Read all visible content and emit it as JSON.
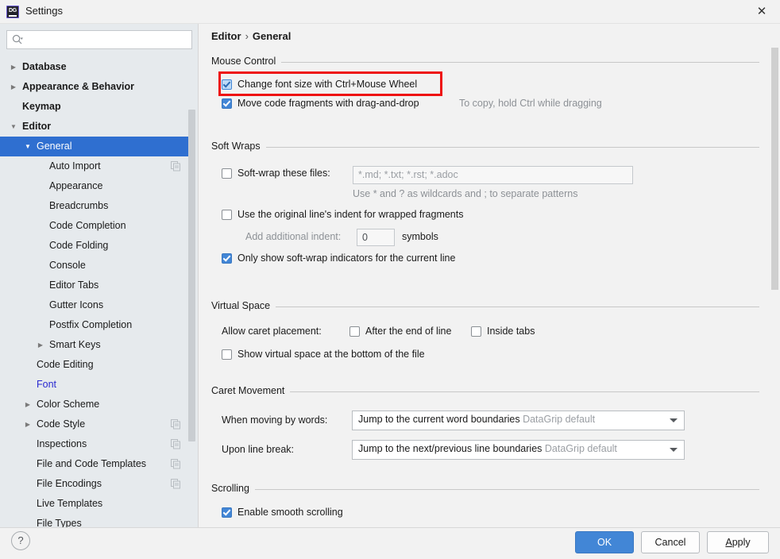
{
  "window": {
    "title": "Settings",
    "app_icon": "datagrip-icon",
    "app_icon_text": "DG",
    "close_label": "✕"
  },
  "sidebar": {
    "search": {
      "placeholder": "",
      "value": "",
      "icon": "search-icon"
    },
    "items": [
      {
        "label": "Database",
        "level": 0,
        "arrow": "collapsed",
        "bold": true,
        "selected": false,
        "copy_icon": false
      },
      {
        "label": "Appearance & Behavior",
        "level": 0,
        "arrow": "collapsed",
        "bold": true,
        "selected": false,
        "copy_icon": false
      },
      {
        "label": "Keymap",
        "level": 0,
        "arrow": "none",
        "bold": true,
        "selected": false,
        "copy_icon": false
      },
      {
        "label": "Editor",
        "level": 0,
        "arrow": "expanded",
        "bold": true,
        "selected": false,
        "copy_icon": false
      },
      {
        "label": "General",
        "level": 1,
        "arrow": "expanded",
        "bold": false,
        "selected": true,
        "copy_icon": false
      },
      {
        "label": "Auto Import",
        "level": 2,
        "arrow": "none",
        "bold": false,
        "selected": false,
        "copy_icon": true
      },
      {
        "label": "Appearance",
        "level": 2,
        "arrow": "none",
        "bold": false,
        "selected": false,
        "copy_icon": false
      },
      {
        "label": "Breadcrumbs",
        "level": 2,
        "arrow": "none",
        "bold": false,
        "selected": false,
        "copy_icon": false
      },
      {
        "label": "Code Completion",
        "level": 2,
        "arrow": "none",
        "bold": false,
        "selected": false,
        "copy_icon": false
      },
      {
        "label": "Code Folding",
        "level": 2,
        "arrow": "none",
        "bold": false,
        "selected": false,
        "copy_icon": false
      },
      {
        "label": "Console",
        "level": 2,
        "arrow": "none",
        "bold": false,
        "selected": false,
        "copy_icon": false
      },
      {
        "label": "Editor Tabs",
        "level": 2,
        "arrow": "none",
        "bold": false,
        "selected": false,
        "copy_icon": false
      },
      {
        "label": "Gutter Icons",
        "level": 2,
        "arrow": "none",
        "bold": false,
        "selected": false,
        "copy_icon": false
      },
      {
        "label": "Postfix Completion",
        "level": 2,
        "arrow": "none",
        "bold": false,
        "selected": false,
        "copy_icon": false
      },
      {
        "label": "Smart Keys",
        "level": 2,
        "arrow": "collapsed",
        "bold": false,
        "selected": false,
        "copy_icon": false
      },
      {
        "label": "Code Editing",
        "level": 1,
        "arrow": "none",
        "bold": false,
        "selected": false,
        "copy_icon": false
      },
      {
        "label": "Font",
        "level": 1,
        "arrow": "none",
        "bold": false,
        "selected": false,
        "copy_icon": false,
        "link": true
      },
      {
        "label": "Color Scheme",
        "level": 1,
        "arrow": "collapsed",
        "bold": false,
        "selected": false,
        "copy_icon": false
      },
      {
        "label": "Code Style",
        "level": 1,
        "arrow": "collapsed",
        "bold": false,
        "selected": false,
        "copy_icon": true
      },
      {
        "label": "Inspections",
        "level": 1,
        "arrow": "none",
        "bold": false,
        "selected": false,
        "copy_icon": true
      },
      {
        "label": "File and Code Templates",
        "level": 1,
        "arrow": "none",
        "bold": false,
        "selected": false,
        "copy_icon": true
      },
      {
        "label": "File Encodings",
        "level": 1,
        "arrow": "none",
        "bold": false,
        "selected": false,
        "copy_icon": true
      },
      {
        "label": "Live Templates",
        "level": 1,
        "arrow": "none",
        "bold": false,
        "selected": false,
        "copy_icon": false
      },
      {
        "label": "File Types",
        "level": 1,
        "arrow": "none",
        "bold": false,
        "selected": false,
        "copy_icon": false
      }
    ]
  },
  "main": {
    "breadcrumb": {
      "parent": "Editor",
      "separator": "›",
      "current": "General"
    },
    "mouse_control": {
      "title": "Mouse Control",
      "change_font_size": {
        "label": "Change font size with Ctrl+Mouse Wheel",
        "checked": true
      },
      "move_fragments": {
        "label": "Move code fragments with drag-and-drop",
        "checked": true
      },
      "move_fragments_hint": "To copy, hold Ctrl while dragging"
    },
    "soft_wraps": {
      "title": "Soft Wraps",
      "soft_wrap_files": {
        "label": "Soft-wrap these files:",
        "checked": false
      },
      "soft_wrap_files_value": "*.md; *.txt; *.rst; *.adoc",
      "wildcard_hint": "Use * and ? as wildcards and ; to separate patterns",
      "original_indent": {
        "label": "Use the original line's indent for wrapped fragments",
        "checked": false
      },
      "additional_indent_label": "Add additional indent:",
      "additional_indent_value": "0",
      "symbols_label": "symbols",
      "only_show_indicators": {
        "label": "Only show soft-wrap indicators for the current line",
        "checked": true
      }
    },
    "virtual_space": {
      "title": "Virtual Space",
      "allow_caret_label": "Allow caret placement:",
      "after_end_of_line": {
        "label": "After the end of line",
        "checked": false
      },
      "inside_tabs": {
        "label": "Inside tabs",
        "checked": false
      },
      "show_virtual_space": {
        "label": "Show virtual space at the bottom of the file",
        "checked": false
      }
    },
    "caret_movement": {
      "title": "Caret Movement",
      "when_moving_label": "When moving by words:",
      "when_moving_value": "Jump to the current word boundaries",
      "when_moving_suffix": "DataGrip default",
      "upon_line_break_label": "Upon line break:",
      "upon_line_break_value": "Jump to the next/previous line boundaries",
      "upon_line_break_suffix": "DataGrip default"
    },
    "scrolling": {
      "title": "Scrolling",
      "enable_smooth": {
        "label": "Enable smooth scrolling",
        "checked": true
      }
    }
  },
  "footer": {
    "help_label": "?",
    "ok_label": "OK",
    "cancel_label": "Cancel",
    "apply_mnemonic": "A",
    "apply_rest": "pply"
  },
  "colors": {
    "accent": "#4286d6",
    "selection": "#2f6fd0",
    "annotation": "#ee1111",
    "link": "#2a2ad0",
    "sidebar_bg": "#e6eaed",
    "panel_bg": "#f2f2f2"
  }
}
